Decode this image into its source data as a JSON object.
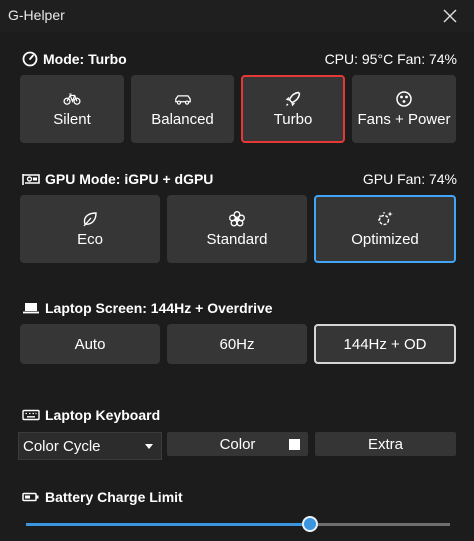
{
  "window": {
    "title": "G-Helper"
  },
  "mode": {
    "header": "Mode: Turbo",
    "info": "CPU: 95°C Fan: 74%",
    "buttons": [
      "Silent",
      "Balanced",
      "Turbo",
      "Fans + Power"
    ],
    "selected": "Turbo"
  },
  "gpu": {
    "header": "GPU Mode: iGPU + dGPU",
    "info": "GPU Fan: 74%",
    "buttons": [
      "Eco",
      "Standard",
      "Optimized"
    ],
    "selected": "Optimized"
  },
  "screen": {
    "header": "Laptop Screen: 144Hz + Overdrive",
    "buttons": [
      "Auto",
      "60Hz",
      "144Hz + OD"
    ],
    "selected": "144Hz + OD"
  },
  "keyboard": {
    "header": "Laptop Keyboard",
    "mode_value": "Color Cycle",
    "color_label": "Color",
    "extra_label": "Extra",
    "color_value": "#ffffff"
  },
  "battery": {
    "header": "Battery Charge Limit",
    "limit_fraction": 0.67
  },
  "colors": {
    "accent_red": "#e53935",
    "accent_blue": "#42a5f5",
    "slider": "#3a95de"
  }
}
